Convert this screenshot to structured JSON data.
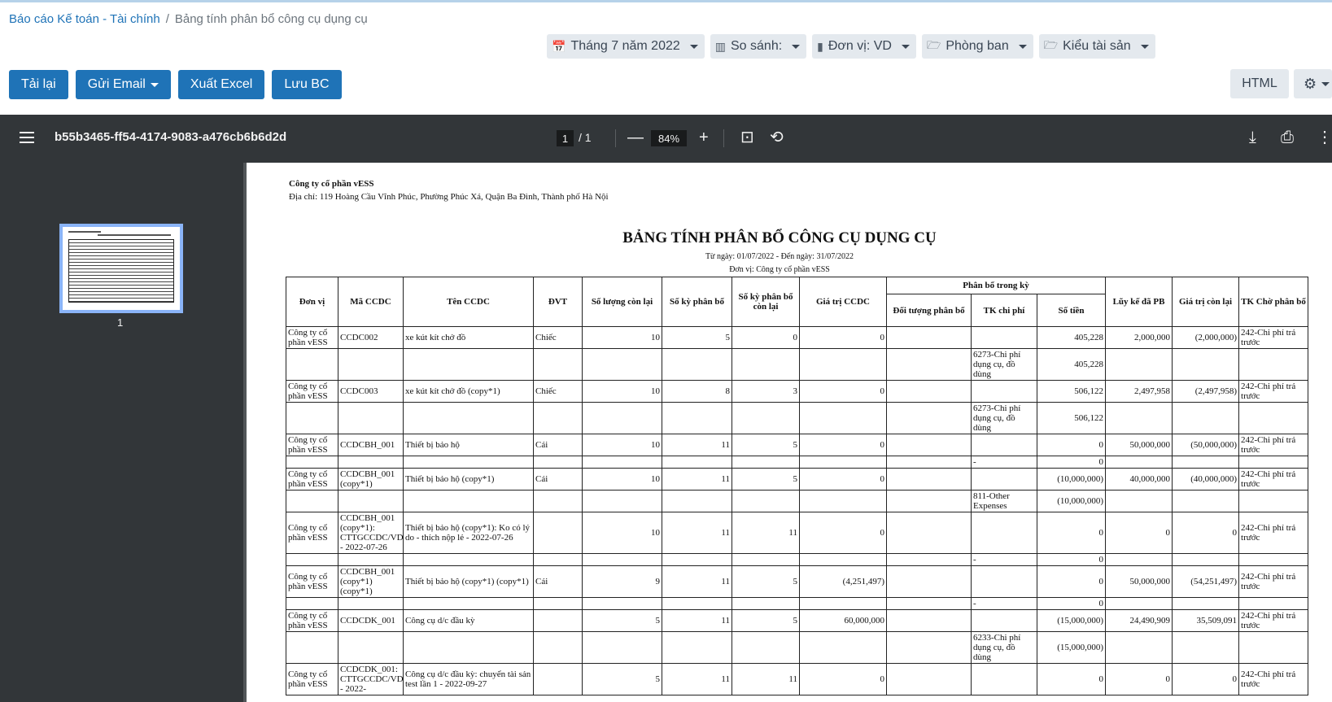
{
  "breadcrumb": {
    "parent": "Báo cáo Kế toán - Tài chính",
    "sep": "/",
    "current": "Bảng tính phân bổ công cụ dụng cụ"
  },
  "filters": {
    "period": "Tháng 7 năm 2022",
    "compare": "So sánh:",
    "unit": "Đơn vị: VD",
    "department": "Phòng ban",
    "asset_type": "Kiểu tài sản"
  },
  "actions": {
    "reload": "Tải lại",
    "send_email": "Gửi Email",
    "export_excel": "Xuất Excel",
    "save_report": "Lưu BC",
    "html": "HTML"
  },
  "icons": {
    "period": "calendar-icon",
    "compare": "bar-chart-icon",
    "unit": "building-icon",
    "department": "folder-open-icon",
    "asset_type": "folder-open-icon",
    "settings": "gear-icon"
  },
  "viewer": {
    "doc_id": "b55b3465-ff54-4174-9083-a476cb6b6d2d",
    "page_current": "1",
    "page_total": "/  1",
    "zoom": "84%",
    "thumb_label": "1"
  },
  "report": {
    "company": "Công ty cổ phần vESS",
    "address": "Địa chỉ: 119 Hoàng Cầu Vĩnh Phúc, Phường Phúc Xá, Quận Ba Đình, Thành phố Hà Nội",
    "title": "BẢNG TÍNH PHÂN BỔ CÔNG CỤ DỤNG CỤ",
    "date_range": "Từ ngày: 01/07/2022 - Đến ngày: 31/07/2022",
    "unit_line": "Đơn vị: Công ty cổ phần vESS",
    "headers": {
      "don_vi": "Đơn vị",
      "ma_ccdc": "Mã CCDC",
      "ten_ccdc": "Tên CCDC",
      "dvt": "ĐVT",
      "so_luong": "Số lượng còn lại",
      "so_ky": "Số kỳ phân bổ",
      "so_ky_con": "Số kỳ phân bổ còn lại",
      "gia_tri": "Giá trị CCDC",
      "phan_bo": "Phân bổ trong kỳ",
      "doi_tuong": "Đối tượng phân bổ",
      "tk_chi_phi": "TK chi phí",
      "so_tien": "Số tiền",
      "luy_ke": "Lũy kế đã PB",
      "con_lai": "Giá trị còn lại",
      "tk_cho": "TK Chờ phân bổ"
    },
    "rows": [
      [
        "Công ty cổ phần vESS",
        "CCDC002",
        "xe kút kít chở đồ",
        "Chiếc",
        "10",
        "5",
        "0",
        "0",
        "",
        "",
        "405,228",
        "2,000,000",
        "(2,000,000)",
        "242-Chi phí trả trước"
      ],
      [
        "",
        "",
        "",
        "",
        "",
        "",
        "",
        "",
        "",
        "6273-Chi phí dụng cụ, đồ dùng",
        "405,228",
        "",
        "",
        ""
      ],
      [
        "Công ty cổ phần vESS",
        "CCDC003",
        "xe kút kít chở đồ (copy*1)",
        "Chiếc",
        "10",
        "8",
        "3",
        "0",
        "",
        "",
        "506,122",
        "2,497,958",
        "(2,497,958)",
        "242-Chi phí trả trước"
      ],
      [
        "",
        "",
        "",
        "",
        "",
        "",
        "",
        "",
        "",
        "6273-Chi phí dụng cụ, đồ dùng",
        "506,122",
        "",
        "",
        ""
      ],
      [
        "Công ty cổ phần vESS",
        "CCDCBH_001",
        "Thiết bị bảo hộ",
        "Cái",
        "10",
        "11",
        "5",
        "0",
        "",
        "",
        "0",
        "50,000,000",
        "(50,000,000)",
        "242-Chi phí trả trước"
      ],
      [
        "",
        "",
        "",
        "",
        "",
        "",
        "",
        "",
        "",
        "-",
        "0",
        "",
        "",
        ""
      ],
      [
        "Công ty cổ phần vESS",
        "CCDCBH_001 (copy*1)",
        "Thiết bị bảo hộ (copy*1)",
        "Cái",
        "10",
        "11",
        "5",
        "0",
        "",
        "",
        "(10,000,000)",
        "40,000,000",
        "(40,000,000)",
        "242-Chi phí trả trước"
      ],
      [
        "",
        "",
        "",
        "",
        "",
        "",
        "",
        "",
        "",
        "811-Other Expenses",
        "(10,000,000)",
        "",
        "",
        ""
      ],
      [
        "Công ty cổ phần vESS",
        "CCDCBH_001 (copy*1): CTTGCCDC/VD/00004 - 2022-07-26",
        "Thiết bị bảo hộ (copy*1): Ko có lý do - thích nộp lẻ - 2022-07-26",
        "",
        "10",
        "11",
        "11",
        "0",
        "",
        "",
        "0",
        "0",
        "0",
        "242-Chi phí trả trước"
      ],
      [
        "",
        "",
        "",
        "",
        "",
        "",
        "",
        "",
        "",
        "-",
        "0",
        "",
        "",
        ""
      ],
      [
        "Công ty cổ phần vESS",
        "CCDCBH_001 (copy*1) (copy*1)",
        "Thiết bị bảo hộ (copy*1) (copy*1)",
        "Cái",
        "9",
        "11",
        "5",
        "(4,251,497)",
        "",
        "",
        "0",
        "50,000,000",
        "(54,251,497)",
        "242-Chi phí trả trước"
      ],
      [
        "",
        "",
        "",
        "",
        "",
        "",
        "",
        "",
        "",
        "-",
        "0",
        "",
        "",
        ""
      ],
      [
        "Công ty cổ phần vESS",
        "CCDCDK_001",
        "Công cụ d/c đầu kỳ",
        "",
        "5",
        "11",
        "5",
        "60,000,000",
        "",
        "",
        "(15,000,000)",
        "24,490,909",
        "35,509,091",
        "242-Chi phí trả trước"
      ],
      [
        "",
        "",
        "",
        "",
        "",
        "",
        "",
        "",
        "",
        "6233-Chi phí dụng cụ, đồ dùng",
        "(15,000,000)",
        "",
        "",
        ""
      ],
      [
        "Công ty cổ phần vESS",
        "CCDCDK_001: CTTGCCDC/VD/00010 - 2022-",
        "Công cụ d/c đầu kỳ: chuyển tài sản test lần 1 - 2022-09-27",
        "",
        "5",
        "11",
        "11",
        "0",
        "",
        "",
        "0",
        "0",
        "0",
        "242-Chi phí trả trước"
      ]
    ]
  }
}
